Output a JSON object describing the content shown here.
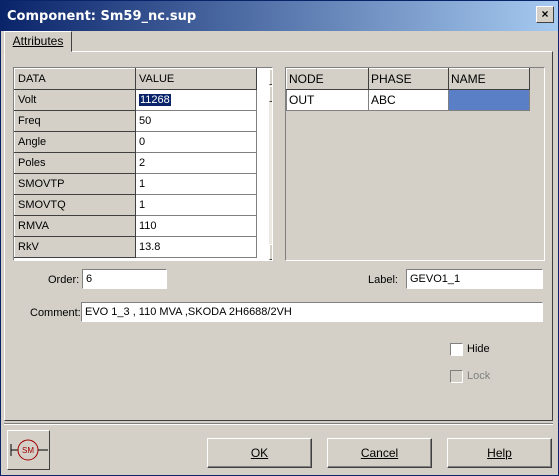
{
  "window": {
    "title": "Component: Sm59_nc.sup",
    "close_label": "×"
  },
  "tabs": [
    {
      "label": "Attributes"
    }
  ],
  "data_grid": {
    "headers": [
      "DATA",
      "VALUE"
    ],
    "rows": [
      {
        "name": "Volt",
        "value": "11268"
      },
      {
        "name": "Freq",
        "value": "50"
      },
      {
        "name": "Angle",
        "value": "0"
      },
      {
        "name": "Poles",
        "value": "2"
      },
      {
        "name": "SMOVTP",
        "value": "1"
      },
      {
        "name": "SMOVTQ",
        "value": "1"
      },
      {
        "name": "RMVA",
        "value": "110"
      },
      {
        "name": "RkV",
        "value": "13.8"
      }
    ]
  },
  "node_grid": {
    "headers": [
      "NODE",
      "PHASE",
      "NAME"
    ],
    "rows": [
      {
        "node": "OUT",
        "phase": "ABC",
        "name": ""
      }
    ]
  },
  "fields": {
    "order_label": "Order:",
    "order_value": "6",
    "label_label": "Label:",
    "label_value": "GEVO1_1",
    "comment_label": "Comment:",
    "comment_value": "EVO 1_3 , 110 MVA ,SKODA 2H6688/2VH"
  },
  "checkboxes": {
    "hide_label": "Hide",
    "hide_checked": false,
    "lock_label": "Lock",
    "lock_checked": false,
    "lock_enabled": false
  },
  "icon": {
    "name": "synchronous-machine-icon",
    "text": "SM"
  },
  "buttons": {
    "ok": "OK",
    "cancel": "Cancel",
    "help": "Help"
  }
}
